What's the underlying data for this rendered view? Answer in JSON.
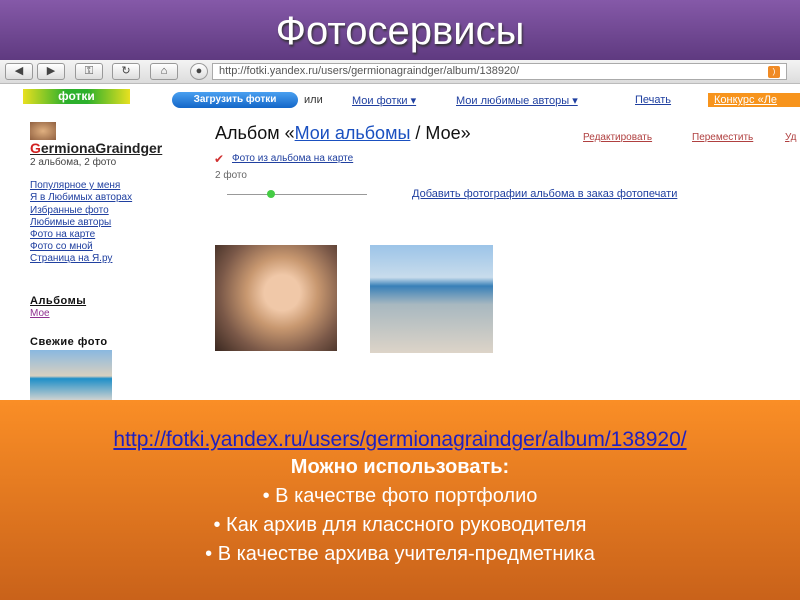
{
  "slide_title": "Фотосервисы",
  "browser": {
    "url": "http://fotki.yandex.ru/users/germionagraindger/album/138920/"
  },
  "site": {
    "logo": "фотки",
    "upload_button": "Загрузить фотки",
    "or": "или",
    "nav": [
      "Мои фотки ▾",
      "Мои любимые авторы ▾",
      "Печать"
    ],
    "contest": "Конкурс «Ле",
    "user": {
      "initial": "G",
      "rest": "ermionaGraindger",
      "stats": "2 альбома, 2 фото"
    },
    "sidebar_links": [
      "Популярное у меня",
      "Я в Любимых авторах",
      "Избранные фото",
      "Любимые авторы",
      "Фото на карте",
      "Фото со мной",
      "Страница на Я.ру"
    ],
    "albums_heading": "Альбомы",
    "album_link": "Мое",
    "fresh_heading": "Свежие фото",
    "album": {
      "prefix": "Альбом «",
      "link": "Мои альбомы",
      "suffix": " / Мое»",
      "actions": [
        "Редактировать",
        "Переместить",
        "Уд"
      ],
      "map_link": "Фото из альбома на карте",
      "count": "2 фото",
      "print_link": "Добавить фотографии альбома в заказ фотопечати"
    }
  },
  "panel": {
    "link": "http://fotki.yandex.ru/users/germionagraindger/album/138920/",
    "lead": "Можно использовать:",
    "bullets": [
      "В качестве фото портфолио",
      "Как архив для классного руководителя",
      "В качестве архива учителя-предметника"
    ]
  }
}
